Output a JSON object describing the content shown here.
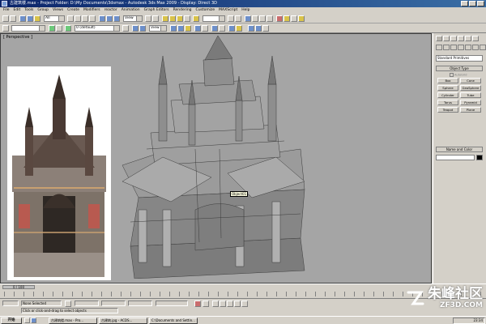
{
  "window": {
    "title": "古建筑楼.max - Project Folder: D:\\My Documents\\3dsmax - Autodesk 3ds Max 2009 - Display: Direct 3D"
  },
  "menubar": {
    "items": [
      "File",
      "Edit",
      "Tools",
      "Group",
      "Views",
      "Create",
      "Modifiers",
      "reactor",
      "Animation",
      "Graph Editors",
      "Rendering",
      "Customize",
      "MAXScript",
      "Help"
    ]
  },
  "toolbar": {
    "selection_filter": "All",
    "reference_coord": "View",
    "named_selection": "",
    "layer": "0 (default)",
    "view2": "View"
  },
  "viewport": {
    "label": "[ Perspective ]",
    "object_tooltip": "Object01"
  },
  "command_panel": {
    "category_dropdown": "Standard Primitives",
    "object_type_title": "Object Type",
    "autogrid_label": "AutoGrid",
    "object_buttons": [
      "Box",
      "Cone",
      "Sphere",
      "GeoSphere",
      "Cylinder",
      "Tube",
      "Torus",
      "Pyramid",
      "Teapot",
      "Plane"
    ],
    "name_color_title": "Name and Color"
  },
  "timeline": {
    "frame_display": "0 / 100",
    "current_frame": 0,
    "total_frames": 100
  },
  "statusbar": {
    "selected_text": "None Selected",
    "prompt_text": "Click or click-and-drag to select objects"
  },
  "taskbar": {
    "start_label": "开始",
    "items": [
      "古建筑楼.max - Pro...",
      "古建筑.jpg - ACDS...",
      "C:\\Documents and Settin..."
    ],
    "clock": "23:34"
  },
  "watermark": {
    "brand": "朱峰社区",
    "site": "ZF3D.COM"
  }
}
